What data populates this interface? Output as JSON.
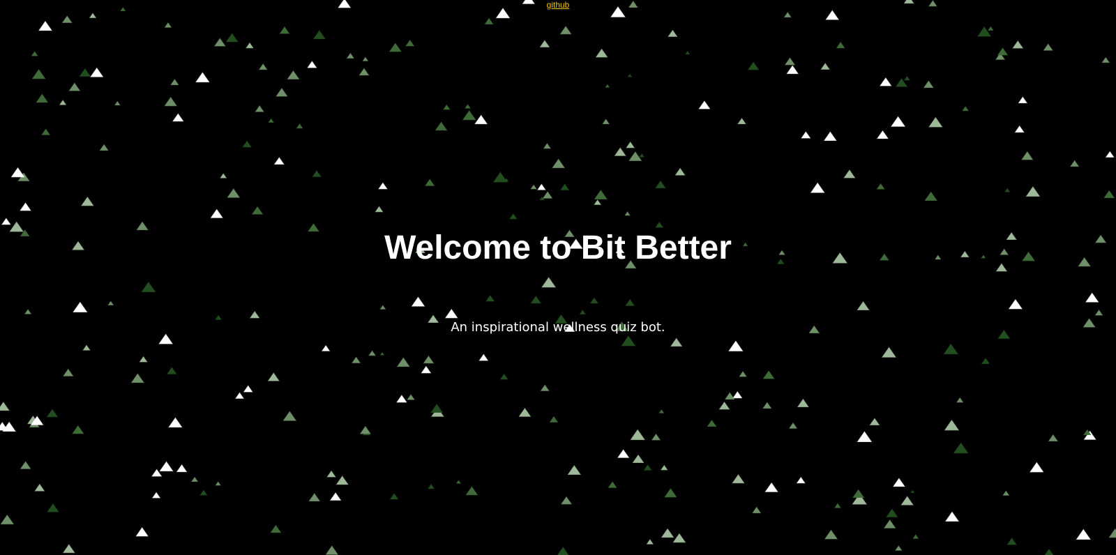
{
  "header": {
    "github_link_label": "github"
  },
  "hero": {
    "title": "Welcome to Bit Better",
    "subtitle": "An inspirational wellness quiz bot."
  },
  "background": {
    "color": "#000000",
    "particle_shape": "triangle-icon",
    "particle_colors": [
      "#ffffff",
      "#9fb89a",
      "#6f8f68",
      "#3f6b38",
      "#224d1f"
    ],
    "link_color": "#f1c40f"
  }
}
